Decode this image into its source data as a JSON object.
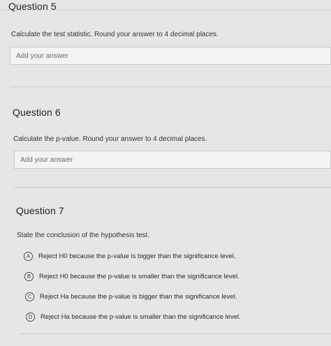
{
  "questions": [
    {
      "title": "Question 5",
      "prompt": "Calculate the test statistic. Round your answer to 4 decimal places.",
      "placeholder": "Add your answer"
    },
    {
      "title": "Question 6",
      "prompt": "Calculate the p-value. Round your answer to 4 decimal places.",
      "placeholder": "Add your answer"
    },
    {
      "title": "Question 7",
      "prompt": "State the conclusion of the hypothesis test.",
      "options": [
        {
          "letter": "A",
          "text": "Reject H0 because the p-value is bigger than the significance level."
        },
        {
          "letter": "B",
          "text": "Reject H0 because the p-value is smaller than the significance level."
        },
        {
          "letter": "C",
          "text": "Reject Ha because the p-value is bigger than the significance level."
        },
        {
          "letter": "D",
          "text": "Reject Ha because the p-value is smaller than the significance level."
        }
      ]
    }
  ]
}
